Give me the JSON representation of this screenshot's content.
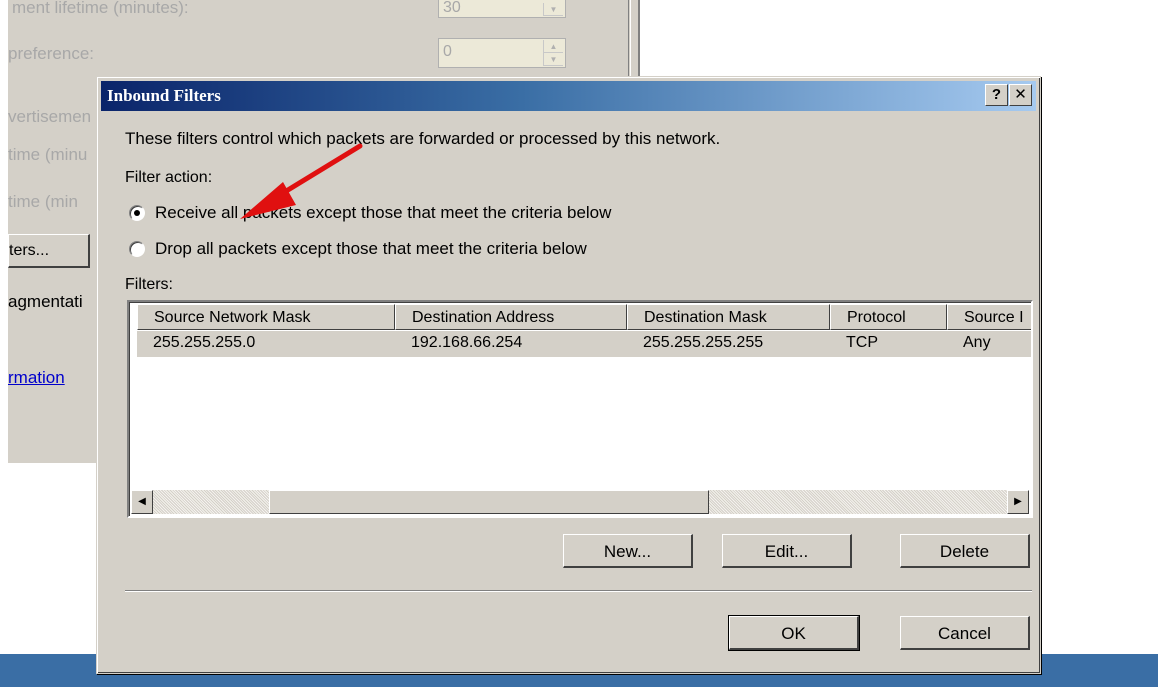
{
  "background_dialog": {
    "labels": [
      "ment lifetime (minutes):",
      "preference:",
      "vertisemen",
      "time (minu",
      "time (min",
      "agmentati"
    ],
    "spin_lifetime_value": "30",
    "spin_preference_value": "0",
    "filters_button_label": "ters...",
    "link_text": "rmation"
  },
  "dialog": {
    "title": "Inbound Filters",
    "help_glyph": "?",
    "close_glyph": "✕",
    "description": "These filters control which packets are forwarded or processed by this network.",
    "filter_action_label": "Filter action:",
    "radio_options": [
      {
        "label": "Receive all packets except those that meet the criteria below",
        "selected": true
      },
      {
        "label": "Drop all packets except those that meet the criteria below",
        "selected": false
      }
    ],
    "filters_label": "Filters:",
    "columns": [
      "Source Network Mask",
      "Destination Address",
      "Destination Mask",
      "Protocol",
      "Source I"
    ],
    "rows": [
      [
        "255.255.255.0",
        "192.168.66.254",
        "255.255.255.255",
        "TCP",
        "Any"
      ]
    ],
    "scroll_left_icon": "◀",
    "scroll_right_icon": "▶",
    "buttons": {
      "new": "New...",
      "edit": "Edit...",
      "delete": "Delete",
      "ok": "OK",
      "cancel": "Cancel"
    },
    "annotation": {
      "icon": "red-arrow-icon",
      "color": "#e01010"
    }
  },
  "taskbar": {
    "color": "#3a6ea5"
  }
}
